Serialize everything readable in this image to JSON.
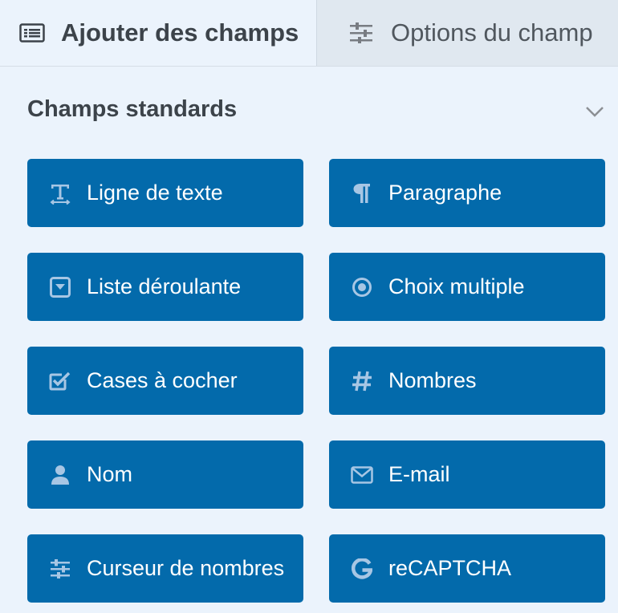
{
  "tabs": [
    {
      "label": "Ajouter des champs",
      "icon": "list-icon",
      "active": true
    },
    {
      "label": "Options du champ",
      "icon": "sliders-icon",
      "active": false
    }
  ],
  "section": {
    "title": "Champs standards",
    "collapse_icon": "chevron-down-icon"
  },
  "fields": [
    {
      "label": "Ligne de texte",
      "icon": "text-icon"
    },
    {
      "label": "Paragraphe",
      "icon": "paragraph-icon"
    },
    {
      "label": "Liste déroulante",
      "icon": "dropdown-icon"
    },
    {
      "label": "Choix multiple",
      "icon": "radio-icon"
    },
    {
      "label": "Cases à cocher",
      "icon": "checkbox-icon"
    },
    {
      "label": "Nombres",
      "icon": "hash-icon"
    },
    {
      "label": "Nom",
      "icon": "user-icon"
    },
    {
      "label": "E-mail",
      "icon": "envelope-icon"
    },
    {
      "label": "Curseur de nombres",
      "icon": "sliders-icon"
    },
    {
      "label": "reCAPTCHA",
      "icon": "google-icon"
    }
  ],
  "colors": {
    "button_bg": "#036aab",
    "button_text": "#ffffff",
    "icon_tint": "#a7c6e4",
    "panel_bg": "#ebf3fc"
  }
}
